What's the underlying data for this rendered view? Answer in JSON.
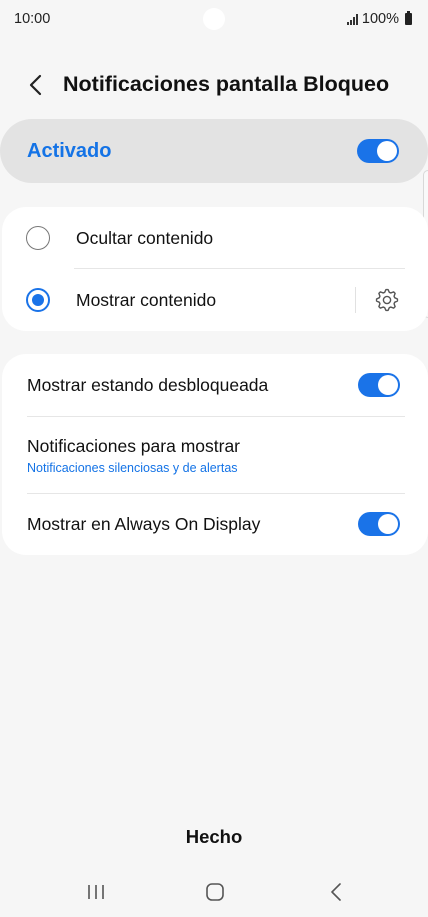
{
  "status_bar": {
    "time": "10:00",
    "battery": "100%"
  },
  "header": {
    "title": "Notificaciones pantalla Bloqueo"
  },
  "master": {
    "label": "Activado",
    "enabled": true
  },
  "options": [
    {
      "label": "Ocultar contenido",
      "selected": false
    },
    {
      "label": "Mostrar contenido",
      "selected": true
    }
  ],
  "settings": {
    "show_unlocked": {
      "label": "Mostrar estando desbloqueada",
      "enabled": true
    },
    "notifications_to_show": {
      "label": "Notificaciones para mostrar",
      "value": "Notificaciones silenciosas y de alertas"
    },
    "always_on_display": {
      "label": "Mostrar en Always On Display",
      "enabled": true
    }
  },
  "footer": {
    "done_label": "Hecho"
  },
  "colors": {
    "accent": "#1a73e8",
    "background": "#f6f6f6",
    "card": "#ffffff"
  },
  "icons": [
    "back-arrow-icon",
    "gear-icon",
    "recent-apps-icon",
    "home-icon",
    "back-icon"
  ]
}
